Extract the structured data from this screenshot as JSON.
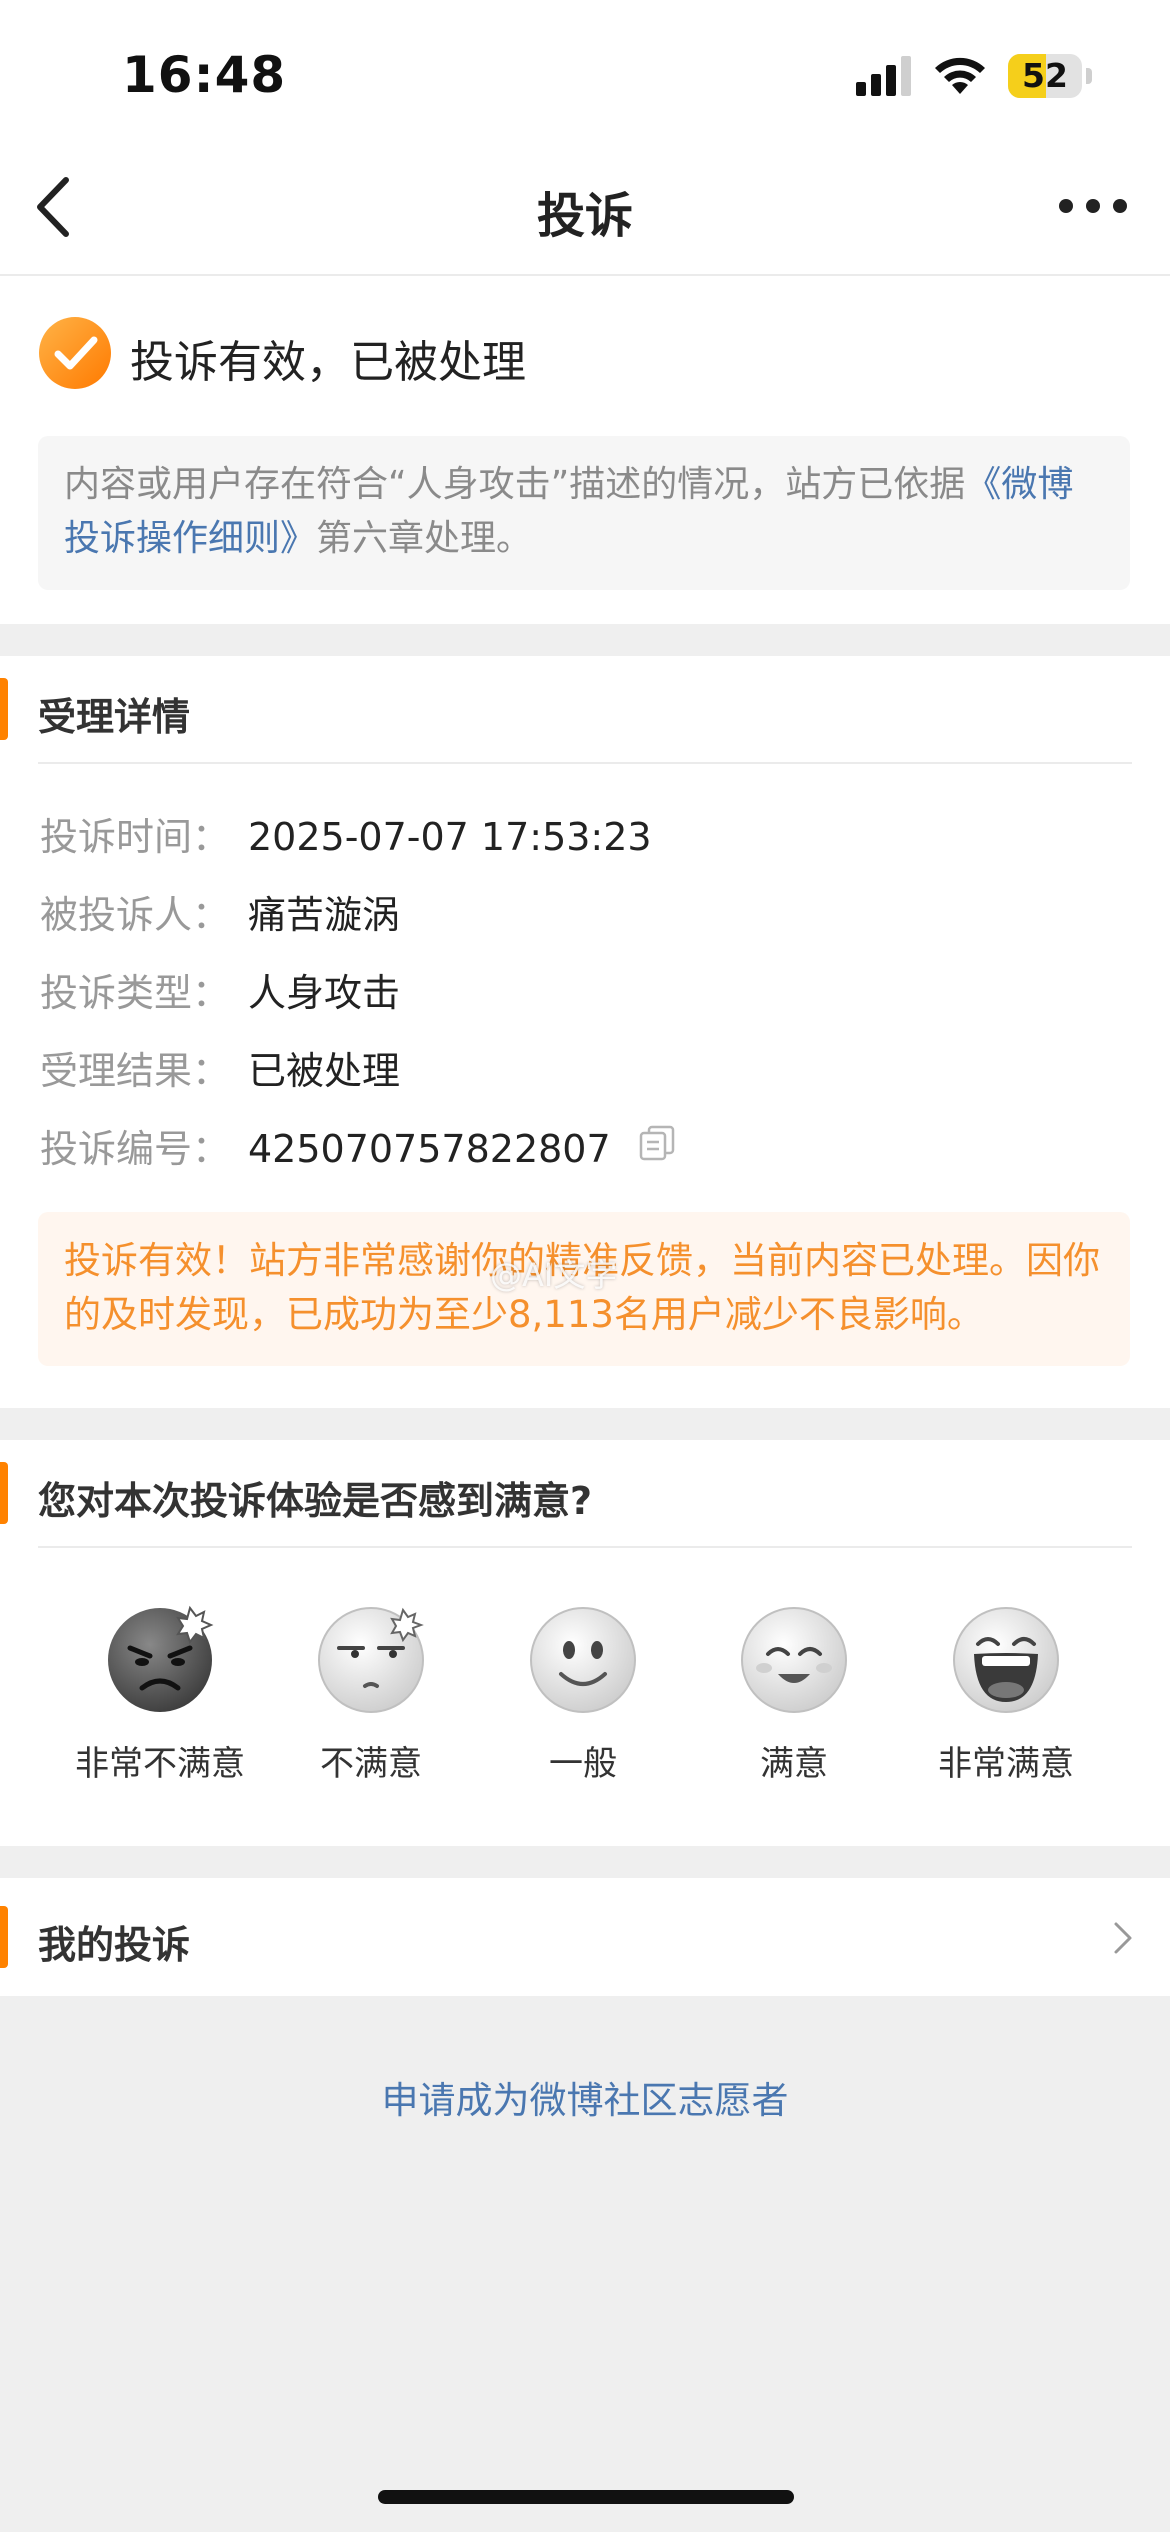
{
  "status_bar": {
    "time": "16:48",
    "battery": "52",
    "battery_level": 0.52
  },
  "nav": {
    "title": "投诉"
  },
  "result": {
    "title": "投诉有效，已被处理",
    "notice_prefix": "内容或用户存在符合“人身攻击”描述的情况，站方已依据",
    "notice_link": "《微博投诉操作细则》",
    "notice_suffix": "第六章处理。"
  },
  "details": {
    "section_title": "受理详情",
    "rows": [
      {
        "label": "投诉时间：",
        "value": "2025-07-07 17:53:23"
      },
      {
        "label": "被投诉人：",
        "value": "痛苦漩涡"
      },
      {
        "label": "投诉类型：",
        "value": "人身攻击"
      },
      {
        "label": "受理结果：",
        "value": "已被处理"
      },
      {
        "label": "投诉编号：",
        "value": "425070757822807"
      }
    ],
    "thanks": "投诉有效！站方非常感谢你的精准反馈，当前内容已处理。因你的及时发现，已成功为至少8,113名用户减少不良影响。"
  },
  "survey": {
    "section_title": "您对本次投诉体验是否感到满意?",
    "options": [
      {
        "label": "非常不满意",
        "icon": "very-angry-face-icon"
      },
      {
        "label": "不满意",
        "icon": "annoyed-face-icon"
      },
      {
        "label": "一般",
        "icon": "neutral-face-icon"
      },
      {
        "label": "满意",
        "icon": "smiling-face-icon"
      },
      {
        "label": "非常满意",
        "icon": "laughing-face-icon"
      }
    ]
  },
  "my_complaints": {
    "label": "我的投诉"
  },
  "volunteer_link": "申请成为微博社区志愿者",
  "watermark": "@AI文字",
  "colors": {
    "accent": "#ff8200",
    "link": "#4a77b0",
    "orange_text": "#f5902d"
  }
}
